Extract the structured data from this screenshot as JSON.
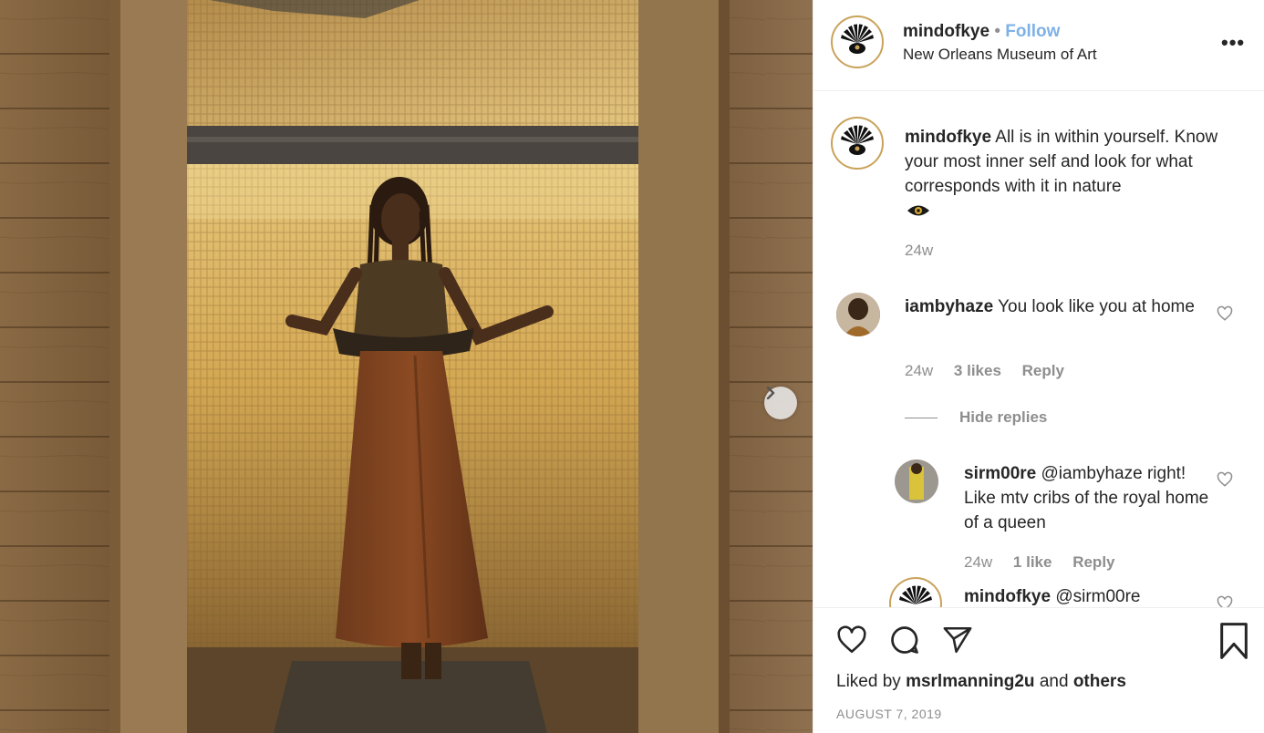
{
  "post": {
    "author": "mindofkye",
    "separator": "•",
    "follow_label": "Follow",
    "location": "New Orleans Museum of Art",
    "more_label": "•••"
  },
  "caption": {
    "username": "mindofkye",
    "text": "All is in within yourself. Know your most inner self and look for what corresponds with it in nature",
    "emoji_icon": "eye-emoji-icon",
    "time": "24w"
  },
  "comments": [
    {
      "username": "iambyhaze",
      "text": "You look like you at home",
      "time": "24w",
      "likes": "3 likes",
      "reply_label": "Reply",
      "hide_replies_label": "Hide replies"
    },
    {
      "username": "sirm00re",
      "text": "@iambyhaze right! Like mtv cribs of the royal home of a queen",
      "time": "24w",
      "likes": "1 like",
      "reply_label": "Reply"
    },
    {
      "username": "mindofkye",
      "text": "@sirm00re"
    }
  ],
  "footer": {
    "liked_prefix": "Liked by",
    "liked_user": "msrlmanning2u",
    "liked_and": "and",
    "liked_others": "others",
    "date": "AUGUST 7, 2019"
  },
  "colors": {
    "follow_blue": "#7fb1e6",
    "text": "#262626",
    "muted": "#8e8e8e",
    "avatar_ring": "#c9a35a"
  }
}
